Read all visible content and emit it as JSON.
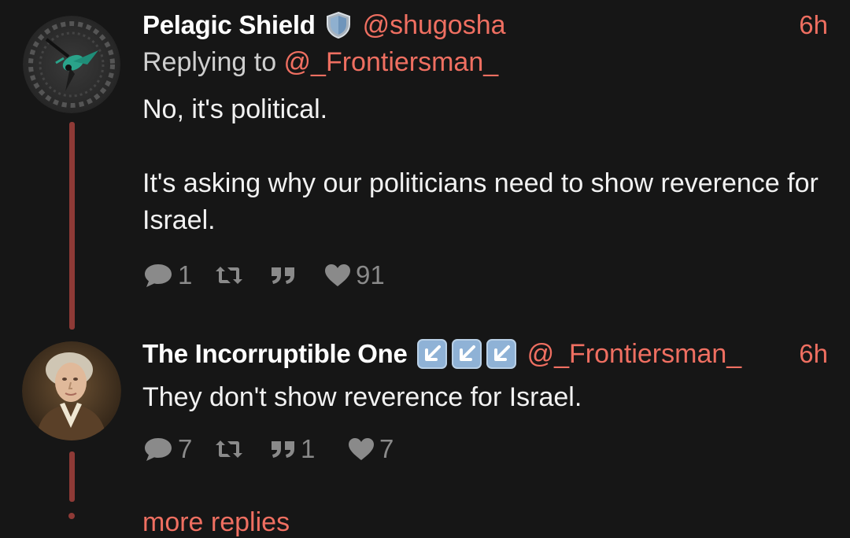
{
  "tweets": [
    {
      "display_name": "Pelagic Shield",
      "name_badge": "shield-emoji",
      "handle": "@shugosha",
      "time": "6h",
      "replying_prefix": "Replying to ",
      "replying_handle": "@_Frontiersman_",
      "body": [
        "No, it's political.",
        "",
        "It's asking why our politicians need to show reverence for Israel."
      ],
      "body_line1": "No, it's political.",
      "body_line2": "It's asking why our politicians need to show reverence for Israel.",
      "replies": "1",
      "retweets": "",
      "quotes": "",
      "likes": "91"
    },
    {
      "display_name": "The Incorruptible One",
      "name_badges": [
        "down-left-arrow-emoji",
        "down-left-arrow-emoji",
        "down-left-arrow-emoji"
      ],
      "handle": "@_Frontiersman_",
      "time": "6h",
      "body_line1": "They don't show reverence for Israel.",
      "replies": "7",
      "retweets": "",
      "quotes": "1",
      "likes": "7"
    }
  ],
  "more_replies": "more replies",
  "colors": {
    "background": "#161616",
    "accent": "#ef6f61",
    "thread_line": "#8e3a36",
    "action_gray": "#8a8a8a",
    "text": "#f2f2f2"
  }
}
